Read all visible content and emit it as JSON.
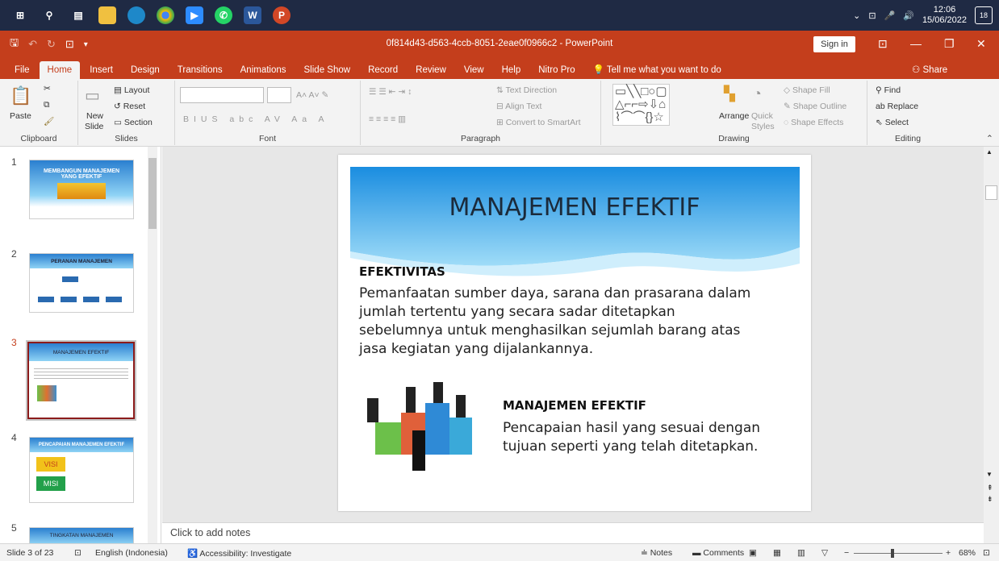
{
  "taskbar": {
    "apps": [
      "start",
      "search",
      "task-view",
      "explorer",
      "edge",
      "chrome",
      "zoom",
      "whatsapp",
      "word",
      "powerpoint"
    ],
    "clock_time": "12:06",
    "clock_date": "15/06/2022",
    "notifications": "18"
  },
  "titlebar": {
    "doc_title": "0f814d43-d563-4ccb-8051-2eae0f0966c2  -  PowerPoint",
    "signin": "Sign in"
  },
  "tabs": [
    "File",
    "Home",
    "Insert",
    "Design",
    "Transitions",
    "Animations",
    "Slide Show",
    "Record",
    "Review",
    "View",
    "Help",
    "Nitro Pro"
  ],
  "active_tab": "Home",
  "tell_me": "Tell me what you want to do",
  "share": "Share",
  "ribbon": {
    "clipboard": {
      "label": "Clipboard",
      "paste": "Paste"
    },
    "slides": {
      "label": "Slides",
      "new_slide": "New",
      "new_slide2": "Slide",
      "layout": "Layout",
      "reset": "Reset",
      "section": "Section"
    },
    "font": {
      "label": "Font"
    },
    "paragraph": {
      "label": "Paragraph",
      "text_direction": "Text Direction",
      "align_text": "Align Text",
      "convert": "Convert to SmartArt"
    },
    "drawing": {
      "label": "Drawing",
      "arrange": "Arrange",
      "quick": "Quick",
      "styles": "Styles",
      "shape_fill": "Shape Fill",
      "shape_outline": "Shape Outline",
      "shape_effects": "Shape Effects"
    },
    "editing": {
      "label": "Editing",
      "find": "Find",
      "replace": "Replace",
      "select": "Select"
    }
  },
  "thumbnails": [
    {
      "num": "1",
      "title": "MEMBANGUN MANAJEMEN YANG EFEKTIF"
    },
    {
      "num": "2",
      "title": "PERANAN MANAJEMEN"
    },
    {
      "num": "3",
      "title": "MANAJEMEN EFEKTIF"
    },
    {
      "num": "4",
      "title": "PENCAPAIAN MANAJEMEN EFEKTIF",
      "visi": "VISI",
      "misi": "MISI"
    },
    {
      "num": "5",
      "title": "TINGKATAN MANAJEMEN"
    }
  ],
  "slide": {
    "title": "MANAJEMEN EFEKTIF",
    "heading1": "EFEKTIVITAS",
    "body1_lines": [
      "Pemanfaatan sumber daya, sarana dan prasarana dalam",
      "jumlah tertentu yang secara sadar ditetapkan",
      "sebelumnya untuk menghasilkan sejumlah barang atas",
      "jasa kegiatan yang dijalankannya."
    ],
    "heading2": "MANAJEMEN EFEKTIF",
    "body2_lines": [
      "Pencapaian hasil yang sesuai dengan",
      "tujuan seperti yang telah ditetapkan."
    ]
  },
  "notes_placeholder": "Click to add notes",
  "status": {
    "slide_of": "Slide 3 of 23",
    "language": "English (Indonesia)",
    "accessibility": "Accessibility: Investigate",
    "notes": "Notes",
    "comments": "Comments",
    "zoom": "68%"
  },
  "colors": {
    "accent": "#c43e1c",
    "taskbar": "#1f2a44",
    "selected_thumb": "#8b1a1a"
  }
}
